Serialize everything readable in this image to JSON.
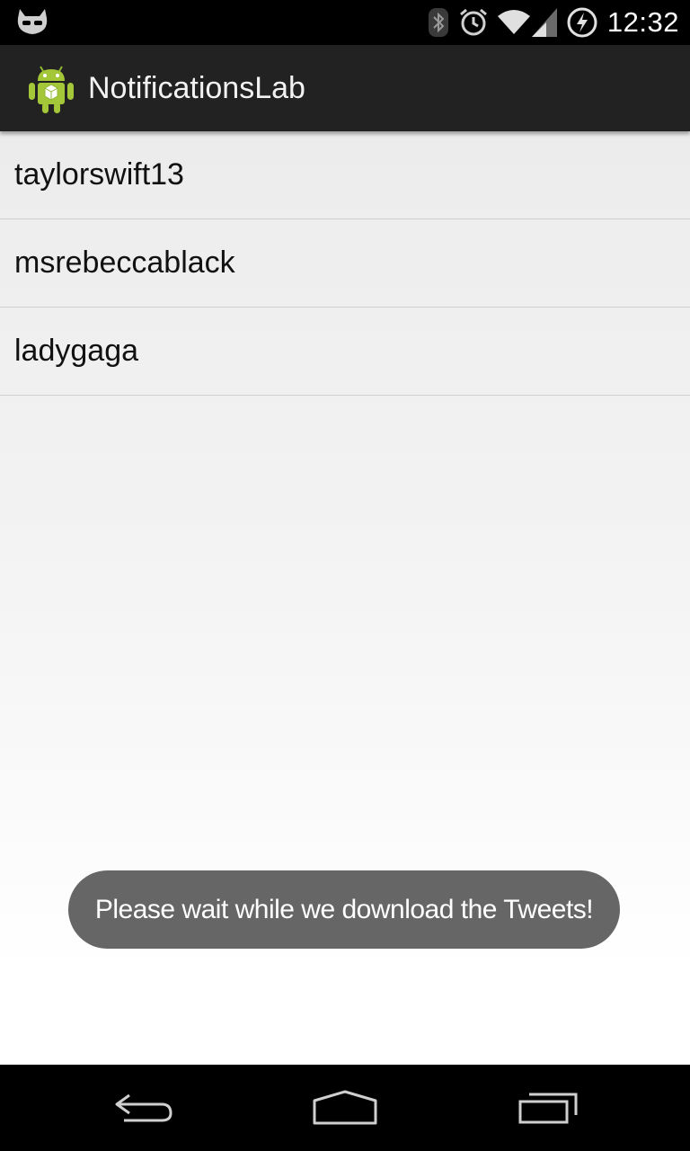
{
  "status_bar": {
    "time": "12:32",
    "left_icon": "cyanogenmod-mascot-icon",
    "icons": [
      "bluetooth-icon",
      "alarm-icon",
      "wifi-icon",
      "signal-icon",
      "battery-charging-icon"
    ]
  },
  "action_bar": {
    "title": "NotificationsLab",
    "icon": "android-app-icon"
  },
  "list": {
    "items": [
      {
        "label": "taylorswift13"
      },
      {
        "label": "msrebeccablack"
      },
      {
        "label": "ladygaga"
      }
    ]
  },
  "toast": {
    "message": "Please wait while we download the Tweets!"
  },
  "nav_bar": {
    "icons": [
      "back-icon",
      "home-icon",
      "recents-icon"
    ]
  },
  "colors": {
    "action_bar_bg": "#222222",
    "toast_bg": "#666666",
    "android_green": "#a4c639"
  }
}
